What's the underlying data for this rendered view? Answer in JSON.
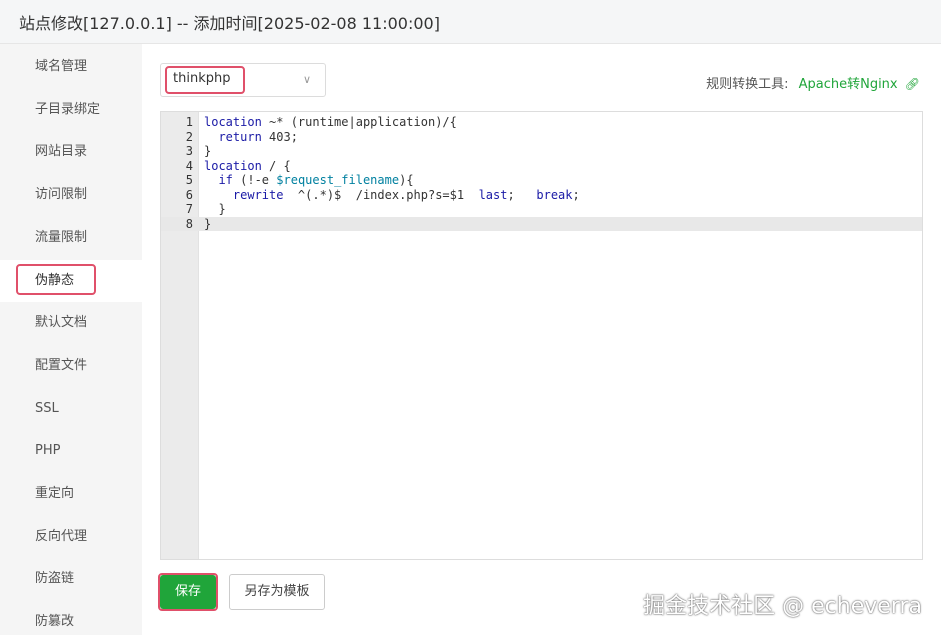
{
  "window": {
    "title": "站点修改[127.0.0.1] -- 添加时间[2025-02-08 11:00:00]"
  },
  "sidebar": {
    "items": [
      {
        "label": "域名管理",
        "active": false
      },
      {
        "label": "子目录绑定",
        "active": false
      },
      {
        "label": "网站目录",
        "active": false
      },
      {
        "label": "访问限制",
        "active": false
      },
      {
        "label": "流量限制",
        "active": false
      },
      {
        "label": "伪静态",
        "active": true
      },
      {
        "label": "默认文档",
        "active": false
      },
      {
        "label": "配置文件",
        "active": false
      },
      {
        "label": "SSL",
        "active": false
      },
      {
        "label": "PHP",
        "active": false
      },
      {
        "label": "重定向",
        "active": false
      },
      {
        "label": "反向代理",
        "active": false
      },
      {
        "label": "防盗链",
        "active": false
      },
      {
        "label": "防篡改",
        "active": false
      }
    ]
  },
  "rewrite": {
    "template_select": {
      "selected": "thinkphp"
    },
    "tool_label": "规则转换工具:",
    "tool_link": "Apache转Nginx",
    "code_lines": [
      "location ~* (runtime|application)/{",
      "  return 403;",
      "}",
      "location / {",
      "  if (!-e $request_filename){",
      "    rewrite  ^(.*)$  /index.php?s=$1  last;   break;",
      "  }",
      "}"
    ],
    "active_line": 8,
    "save_label": "保存",
    "save_template_label": "另存为模板"
  },
  "watermark": "掘金技术社区 @ echeverra",
  "colors": {
    "accent_green": "#20a53a",
    "highlight_red": "#e0506a",
    "sidebar_bg": "#f5f5f5"
  }
}
